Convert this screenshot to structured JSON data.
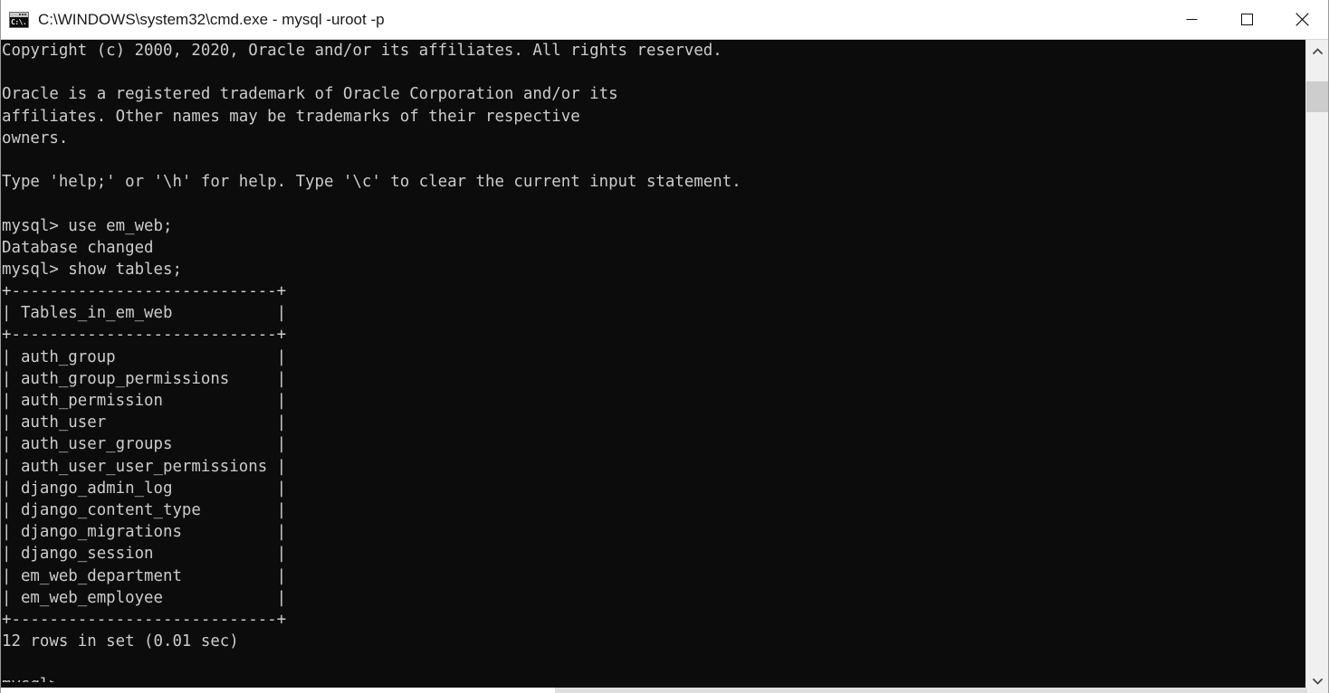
{
  "window": {
    "title": "C:\\WINDOWS\\system32\\cmd.exe - mysql  -uroot -p",
    "icon_name": "cmd-console-icon",
    "icon_text": "C:\\.",
    "colors": {
      "titlebar_bg": "#ffffff",
      "titlebar_fg": "#1a1a1a",
      "console_bg": "#0c0c0c",
      "console_fg": "#cccccc",
      "scrollbar_track": "#f0f0f0",
      "scrollbar_thumb": "#cdcdcd"
    },
    "controls": {
      "minimize_label": "Minimize",
      "maximize_label": "Maximize",
      "close_label": "Close"
    }
  },
  "console": {
    "lines": [
      "Copyright (c) 2000, 2020, Oracle and/or its affiliates. All rights reserved.",
      "",
      "Oracle is a registered trademark of Oracle Corporation and/or its",
      "affiliates. Other names may be trademarks of their respective",
      "owners.",
      "",
      "Type 'help;' or '\\h' for help. Type '\\c' to clear the current input statement.",
      "",
      "mysql> use em_web;",
      "Database changed",
      "mysql> show tables;",
      "+----------------------------+",
      "| Tables_in_em_web           |",
      "+----------------------------+",
      "| auth_group                 |",
      "| auth_group_permissions     |",
      "| auth_permission            |",
      "| auth_user                  |",
      "| auth_user_groups           |",
      "| auth_user_user_permissions |",
      "| django_admin_log           |",
      "| django_content_type        |",
      "| django_migrations          |",
      "| django_session             |",
      "| em_web_department          |",
      "| em_web_employee            |",
      "+----------------------------+",
      "12 rows in set (0.01 sec)",
      "",
      "mysql>"
    ],
    "prompt": "mysql>",
    "database": "em_web",
    "commands": [
      "use em_web;",
      "show tables;"
    ],
    "result_table": {
      "header": "Tables_in_em_web",
      "rows": [
        "auth_group",
        "auth_group_permissions",
        "auth_permission",
        "auth_user",
        "auth_user_groups",
        "auth_user_user_permissions",
        "django_admin_log",
        "django_content_type",
        "django_migrations",
        "django_session",
        "em_web_department",
        "em_web_employee"
      ],
      "row_count_text": "12 rows in set (0.01 sec)",
      "row_count": 12,
      "elapsed_sec": "0.01"
    }
  },
  "scrollbar": {
    "up_arrow_icon": "chevron-up-icon",
    "down_arrow_icon": "chevron-down-icon",
    "thumb_position_pct": 3,
    "thumb_size_pct": 5
  }
}
